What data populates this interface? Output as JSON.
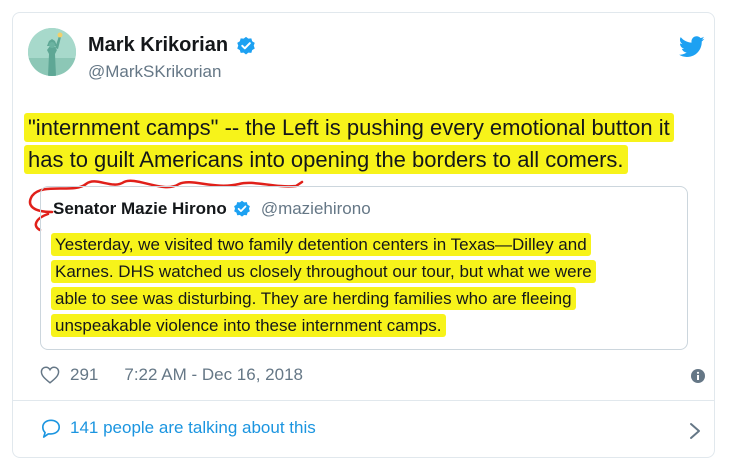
{
  "author": {
    "name": "Mark Krikorian",
    "handle": "@MarkSKrikorian",
    "avatar_icon": "statue-of-liberty-avatar",
    "verified": true
  },
  "tweet": {
    "line1": "\"internment camps\" -- the Left is pushing every emotional button it",
    "line2": "has to guilt Americans into opening the borders to all comers."
  },
  "quoted_tweet": {
    "name": "Senator Mazie Hirono",
    "handle": "@maziehirono",
    "verified": true,
    "lines": [
      "Yesterday, we visited two family detention centers in Texas—Dilley and",
      "Karnes. DHS watched us closely throughout our tour, but what we were",
      "able to see was disturbing. They are herding families who are fleeing",
      "unspeakable violence into these internment camps."
    ]
  },
  "stats": {
    "likes": "291",
    "timestamp": "7:22 AM - Dec 16, 2018"
  },
  "footer": {
    "talking_label": "141 people are talking about this"
  },
  "colors": {
    "highlight": "#f7f31a",
    "link_blue": "#1b95e0",
    "twitter_blue": "#1da1f2",
    "gray_text": "#657786",
    "annotation_red": "#e0201a"
  }
}
